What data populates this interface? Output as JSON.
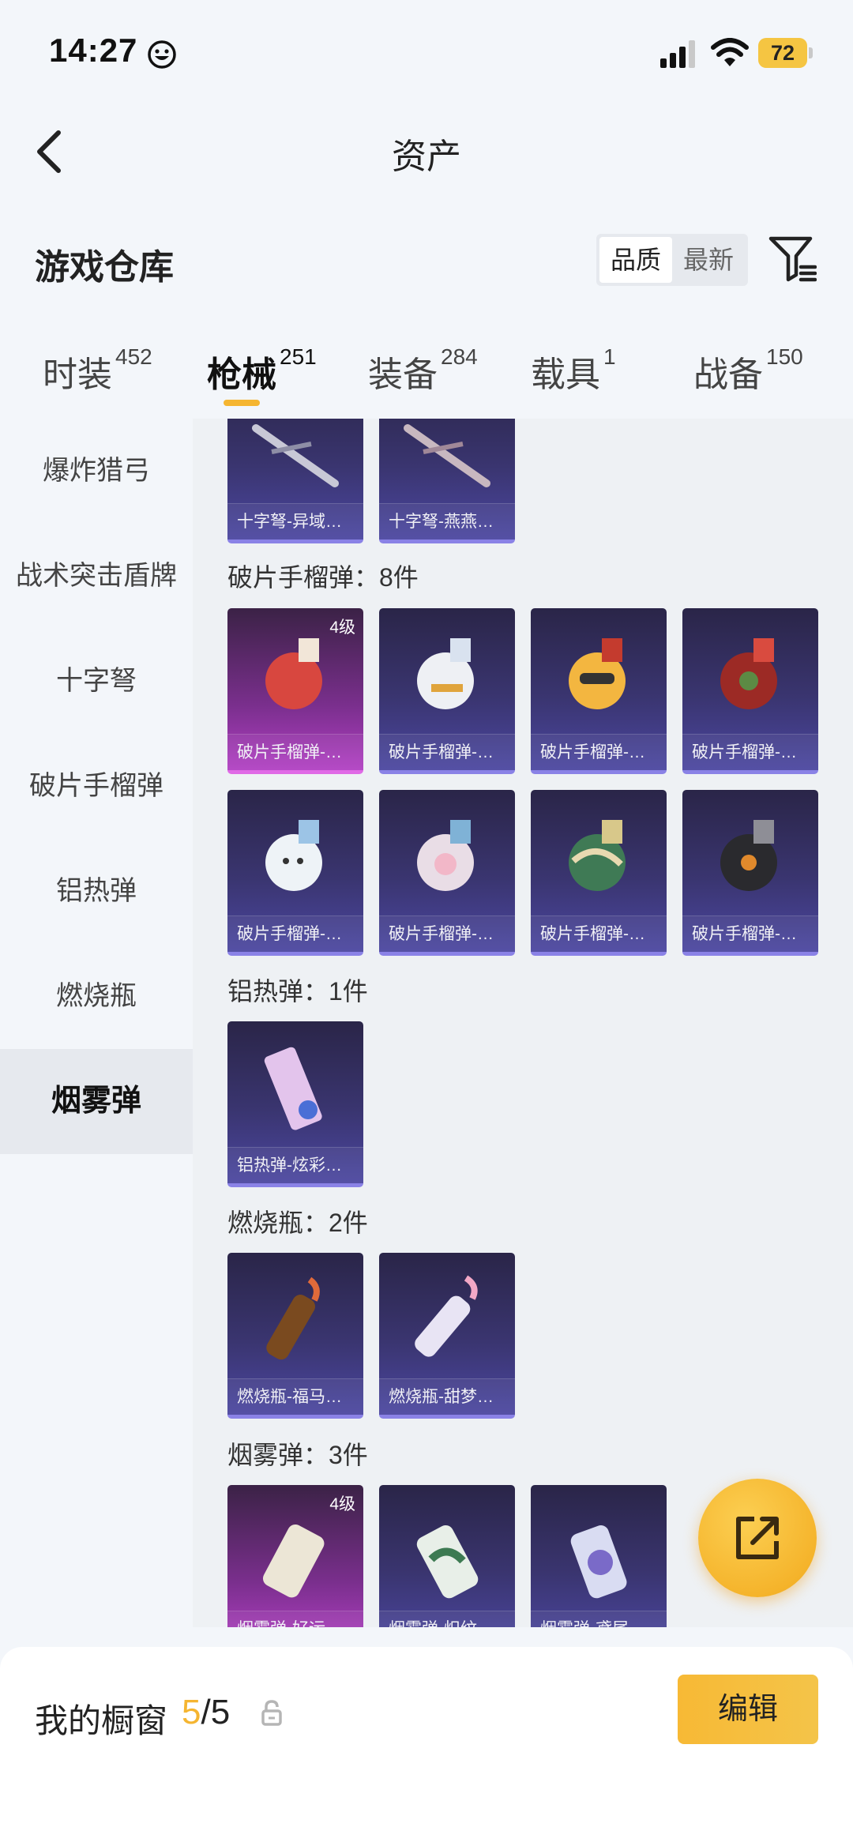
{
  "status_bar": {
    "time": "14:27",
    "battery": "72"
  },
  "nav": {
    "title": "资产"
  },
  "header": {
    "section_title": "游戏仓库",
    "sort_quality": "品质",
    "sort_latest": "最新"
  },
  "tabs": [
    {
      "label": "时装",
      "count": "452"
    },
    {
      "label": "枪械",
      "count": "251"
    },
    {
      "label": "装备",
      "count": "284"
    },
    {
      "label": "载具",
      "count": "1"
    },
    {
      "label": "战备",
      "count": "150"
    }
  ],
  "active_tab": "枪械",
  "sidebar": {
    "items": [
      "爆炸猎弓",
      "战术突击盾牌",
      "十字弩",
      "破片手榴弹",
      "铝热弹",
      "燃烧瓶",
      "烟雾弹"
    ],
    "active": "烟雾弹"
  },
  "groups": {
    "crossbow": {
      "items": [
        "十字弩-异域…",
        "十字弩-燕燕…"
      ]
    },
    "frag": {
      "title": "破片手榴弹：8件",
      "items": [
        "破片手榴弹-…",
        "破片手榴弹-…",
        "破片手榴弹-…",
        "破片手榴弹-…",
        "破片手榴弹-…",
        "破片手榴弹-…",
        "破片手榴弹-…",
        "破片手榴弹-…"
      ],
      "level_badge": "4级"
    },
    "thermite": {
      "title": "铝热弹：1件",
      "items": [
        "铝热弹-炫彩…"
      ]
    },
    "molotov": {
      "title": "燃烧瓶：2件",
      "items": [
        "燃烧瓶-福马…",
        "燃烧瓶-甜梦…"
      ]
    },
    "smoke": {
      "title": "烟雾弹：3件",
      "items": [
        "烟雾弹-好运…",
        "烟雾弹-炽纹…",
        "烟雾弹-鸢尾…"
      ],
      "level_badge": "4级"
    }
  },
  "bottom": {
    "showcase_label": "我的橱窗",
    "showcase_current": "5",
    "showcase_total": "/5",
    "edit_label": "编辑"
  },
  "colors": {
    "accent": "#f5b531",
    "card_purple": "#3a3570",
    "card_pink": "#b13fc3"
  },
  "icons": [
    "smiley-icon",
    "signal-icon",
    "wifi-icon",
    "back-icon",
    "filter-icon",
    "share-icon",
    "lock-icon"
  ]
}
